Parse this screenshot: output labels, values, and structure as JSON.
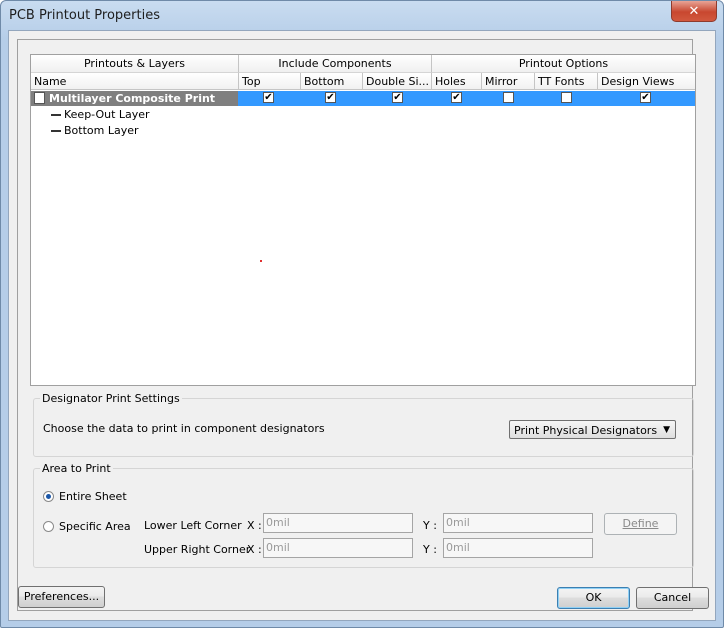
{
  "window": {
    "title": "PCB Printout Properties"
  },
  "grid": {
    "group_headers": [
      "Printouts & Layers",
      "Include Components",
      "Printout Options"
    ],
    "columns": [
      "Name",
      "Top",
      "Bottom",
      "Double Si...",
      "Holes",
      "Mirror",
      "TT Fonts",
      "Design Views"
    ],
    "printout": {
      "name": "Multilayer Composite Print",
      "checks": {
        "top": true,
        "bottom": true,
        "double_sided": true,
        "holes": true,
        "mirror": false,
        "tt_fonts": false,
        "design_views": true
      }
    },
    "layers": [
      "Keep-Out Layer",
      "Bottom Layer"
    ]
  },
  "designator": {
    "title": "Designator Print Settings",
    "label": "Choose the data to print in component designators",
    "selected": "Print Physical Designators"
  },
  "area": {
    "title": "Area to Print",
    "entire_sheet": "Entire Sheet",
    "specific_area": "Specific Area",
    "lower_left": "Lower Left Corner",
    "upper_right": "Upper Right Corner",
    "x_label": "X :",
    "y_label": "Y :",
    "ll_x": "0mil",
    "ll_y": "0mil",
    "ur_x": "0mil",
    "ur_y": "0mil",
    "define": "Define"
  },
  "buttons": {
    "preferences": "Preferences...",
    "ok": "OK",
    "cancel": "Cancel"
  }
}
